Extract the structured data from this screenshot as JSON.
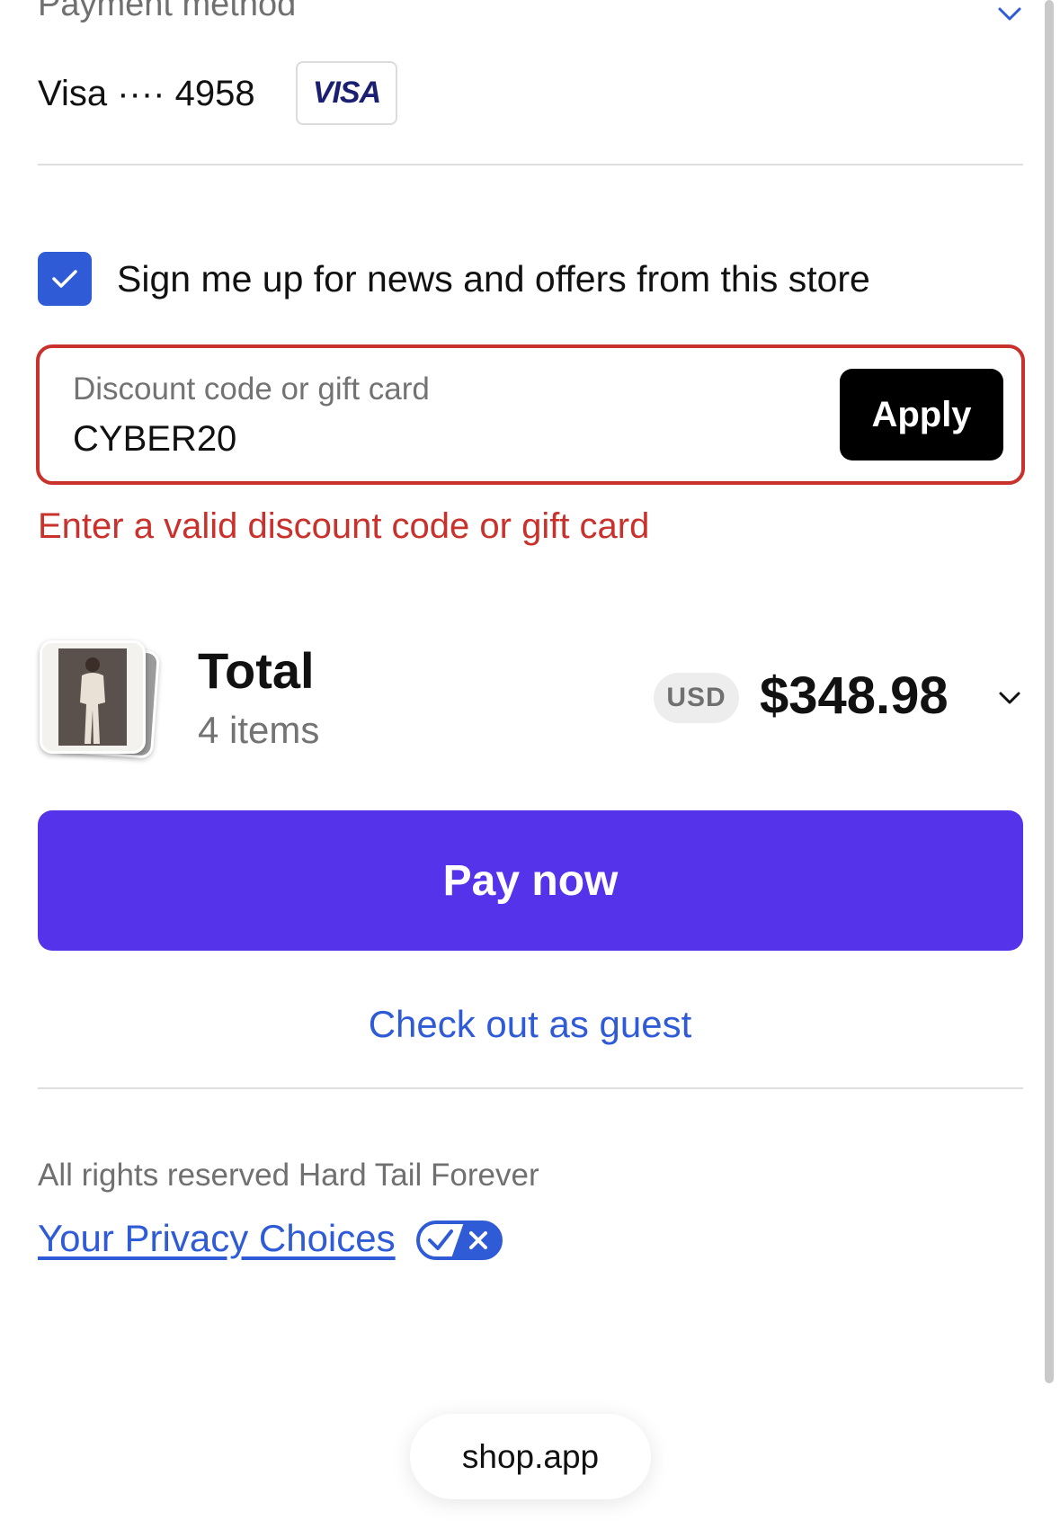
{
  "payment": {
    "title": "Payment method",
    "card_label": "Visa ···· 4958",
    "card_brand": "VISA"
  },
  "newsletter": {
    "checked": true,
    "label": "Sign me up for news and offers from this store"
  },
  "discount": {
    "placeholder": "Discount code or gift card",
    "value": "CYBER20",
    "apply_label": "Apply",
    "error": "Enter a valid discount code or gift card"
  },
  "summary": {
    "total_label": "Total",
    "items_count": "4 items",
    "currency": "USD",
    "amount": "$348.98"
  },
  "actions": {
    "pay_label": "Pay now",
    "guest_label": "Check out as guest"
  },
  "footer": {
    "rights": "All rights reserved Hard Tail Forever",
    "privacy_label": "Your Privacy Choices"
  },
  "address_bar": {
    "domain": "shop.app"
  },
  "colors": {
    "accent": "#5433eb",
    "link": "#2f5bd6",
    "error": "#c9312c",
    "checkbox": "#2f5bd6"
  },
  "icons": {
    "payment_chevron": "chevron-down-icon",
    "checkbox": "check-icon",
    "total_chevron": "chevron-down-icon",
    "privacy": "privacy-choices-icon"
  }
}
